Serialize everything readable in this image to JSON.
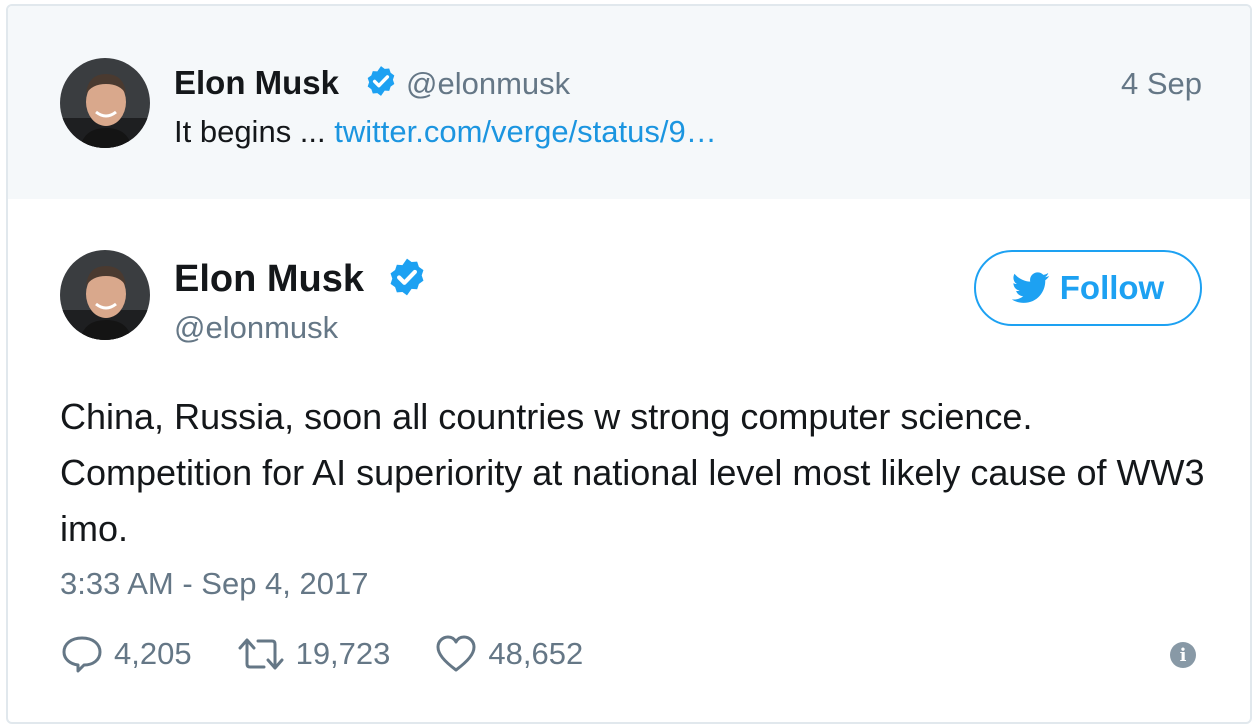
{
  "parent_tweet": {
    "author_name": "Elon Musk",
    "handle": "@elonmusk",
    "date": "4 Sep",
    "text": "It begins ...",
    "link_text": "twitter.com/verge/status/9…"
  },
  "main_tweet": {
    "author_name": "Elon Musk",
    "handle": "@elonmusk",
    "follow_label": "Follow",
    "text": "China, Russia, soon all countries w strong computer science. Competition for AI superiority at national level most likely cause of WW3 imo.",
    "timestamp": "3:33 AM - Sep 4, 2017",
    "replies": "4,205",
    "retweets": "19,723",
    "likes": "48,652"
  },
  "icons": {
    "verified": "verified-badge-icon",
    "bird": "twitter-bird-icon",
    "reply": "reply-icon",
    "retweet": "retweet-icon",
    "like": "heart-icon",
    "info": "info-icon"
  },
  "colors": {
    "brand_blue": "#1da1f2",
    "link_blue": "#1b95e0",
    "secondary_text": "#657786",
    "parent_background": "#f5f8fa"
  }
}
